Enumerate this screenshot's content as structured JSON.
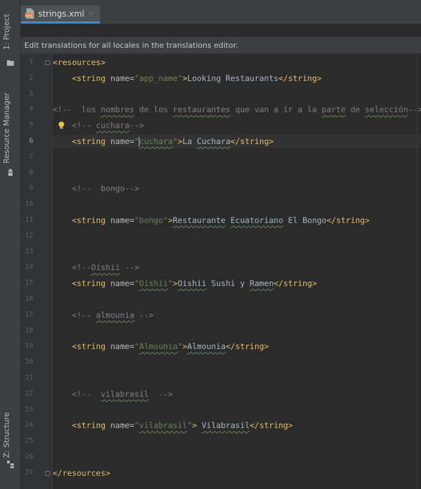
{
  "sidebar": {
    "project_label": "1: Project",
    "resource_manager_label": "Resource Manager",
    "structure_label": "Z: Structure"
  },
  "tab": {
    "title": "strings.xml",
    "close_glyph": "×",
    "icon": "xml-file-icon"
  },
  "banner": {
    "text": "Edit translations for all locales in the translations editor."
  },
  "editor": {
    "current_line": 6,
    "lines": [
      {
        "n": "1",
        "segs": [
          {
            "t": "<resources>",
            "c": "tag"
          }
        ]
      },
      {
        "n": "2",
        "segs": [
          {
            "t": "    ",
            "c": "txt"
          },
          {
            "t": "<string ",
            "c": "tag"
          },
          {
            "t": "name=",
            "c": "attr"
          },
          {
            "t": "\"app_name\"",
            "c": "val"
          },
          {
            "t": ">",
            "c": "tag"
          },
          {
            "t": "Looking Restaurants",
            "c": "txt"
          },
          {
            "t": "</string>",
            "c": "tag"
          }
        ]
      },
      {
        "n": "3",
        "segs": []
      },
      {
        "n": "4",
        "segs": [
          {
            "t": "<!--  los ",
            "c": "cmt"
          },
          {
            "t": "nombres",
            "c": "cmt typo"
          },
          {
            "t": " de los ",
            "c": "cmt"
          },
          {
            "t": "restaurantes",
            "c": "cmt typo"
          },
          {
            "t": " que van a ir a la ",
            "c": "cmt"
          },
          {
            "t": "parte",
            "c": "cmt typo"
          },
          {
            "t": " de ",
            "c": "cmt"
          },
          {
            "t": "selección",
            "c": "cmt typo"
          },
          {
            "t": "-->",
            "c": "cmt"
          }
        ]
      },
      {
        "n": "5",
        "segs": [
          {
            "t": "    <!-- ",
            "c": "cmt"
          },
          {
            "t": "cuchara",
            "c": "cmt typo"
          },
          {
            "t": "-->",
            "c": "cmt"
          }
        ]
      },
      {
        "n": "6",
        "segs": [
          {
            "t": "    ",
            "c": "txt"
          },
          {
            "t": "<string ",
            "c": "tag"
          },
          {
            "t": "name=",
            "c": "attr"
          },
          {
            "t": "\"",
            "c": "val"
          },
          {
            "t": "|",
            "c": "caret"
          },
          {
            "t": "cuchara",
            "c": "val typo"
          },
          {
            "t": "\"",
            "c": "val"
          },
          {
            "t": ">",
            "c": "tag"
          },
          {
            "t": "La ",
            "c": "txt"
          },
          {
            "t": "Cuchara",
            "c": "txt typo"
          },
          {
            "t": "</string>",
            "c": "tag"
          }
        ]
      },
      {
        "n": "7",
        "segs": []
      },
      {
        "n": "8",
        "segs": []
      },
      {
        "n": "9",
        "segs": [
          {
            "t": "    <!--  bongo-->",
            "c": "cmt"
          }
        ]
      },
      {
        "n": "10",
        "segs": []
      },
      {
        "n": "11",
        "segs": [
          {
            "t": "    ",
            "c": "txt"
          },
          {
            "t": "<string ",
            "c": "tag"
          },
          {
            "t": "name=",
            "c": "attr"
          },
          {
            "t": "\"bongo\"",
            "c": "val"
          },
          {
            "t": ">",
            "c": "tag"
          },
          {
            "t": "Restaurante",
            "c": "txt typo"
          },
          {
            "t": " ",
            "c": "txt"
          },
          {
            "t": "Ecuatoriano",
            "c": "txt typo"
          },
          {
            "t": " El Bongo",
            "c": "txt"
          },
          {
            "t": "</string>",
            "c": "tag"
          }
        ]
      },
      {
        "n": "12",
        "segs": []
      },
      {
        "n": "13",
        "segs": []
      },
      {
        "n": "14",
        "segs": [
          {
            "t": "    <!--",
            "c": "cmt"
          },
          {
            "t": "Oishii",
            "c": "cmt typo"
          },
          {
            "t": " -->",
            "c": "cmt"
          }
        ]
      },
      {
        "n": "15",
        "segs": [
          {
            "t": "    ",
            "c": "txt"
          },
          {
            "t": "<string ",
            "c": "tag"
          },
          {
            "t": "name=",
            "c": "attr"
          },
          {
            "t": "\"",
            "c": "val"
          },
          {
            "t": "Oishii",
            "c": "val typo"
          },
          {
            "t": "\"",
            "c": "val"
          },
          {
            "t": ">",
            "c": "tag"
          },
          {
            "t": "Oishii",
            "c": "txt typo"
          },
          {
            "t": " Sushi y ",
            "c": "txt"
          },
          {
            "t": "Ramen",
            "c": "txt typo"
          },
          {
            "t": "</string>",
            "c": "tag"
          }
        ]
      },
      {
        "n": "16",
        "segs": []
      },
      {
        "n": "17",
        "segs": [
          {
            "t": "    <!-- ",
            "c": "cmt"
          },
          {
            "t": "almounia",
            "c": "cmt typo"
          },
          {
            "t": " -->",
            "c": "cmt"
          }
        ]
      },
      {
        "n": "18",
        "segs": []
      },
      {
        "n": "19",
        "segs": [
          {
            "t": "    ",
            "c": "txt"
          },
          {
            "t": "<string ",
            "c": "tag"
          },
          {
            "t": "name=",
            "c": "attr"
          },
          {
            "t": "\"",
            "c": "val"
          },
          {
            "t": "Almounia",
            "c": "val typo"
          },
          {
            "t": "\"",
            "c": "val"
          },
          {
            "t": ">",
            "c": "tag"
          },
          {
            "t": "Almounia",
            "c": "txt typo"
          },
          {
            "t": "</string>",
            "c": "tag"
          }
        ]
      },
      {
        "n": "20",
        "segs": []
      },
      {
        "n": "21",
        "segs": []
      },
      {
        "n": "22",
        "segs": [
          {
            "t": "    <!--  ",
            "c": "cmt"
          },
          {
            "t": "vilabrasil",
            "c": "cmt typo"
          },
          {
            "t": "  -->",
            "c": "cmt"
          }
        ]
      },
      {
        "n": "23",
        "segs": []
      },
      {
        "n": "24",
        "segs": [
          {
            "t": "    ",
            "c": "txt"
          },
          {
            "t": "<string ",
            "c": "tag"
          },
          {
            "t": "name=",
            "c": "attr"
          },
          {
            "t": "\"",
            "c": "val"
          },
          {
            "t": "vilabrasil",
            "c": "val typo"
          },
          {
            "t": "\"",
            "c": "val"
          },
          {
            "t": ">",
            "c": "tag"
          },
          {
            "t": " ",
            "c": "txt"
          },
          {
            "t": "Vilabrasil",
            "c": "txt typo"
          },
          {
            "t": "</string>",
            "c": "tag"
          }
        ]
      },
      {
        "n": "25",
        "segs": []
      },
      {
        "n": "26",
        "segs": []
      },
      {
        "n": "27",
        "segs": [
          {
            "t": "</resources>",
            "c": "tag"
          }
        ]
      }
    ]
  },
  "colors": {
    "background": "#2b2b2b",
    "gutter": "#313335",
    "tag": "#e8bf6a",
    "string_value": "#6a8759",
    "comment": "#808080",
    "text": "#a9b7c6",
    "tab_underline": "#4a88c7",
    "intention_bulb": "#f0c33c"
  }
}
